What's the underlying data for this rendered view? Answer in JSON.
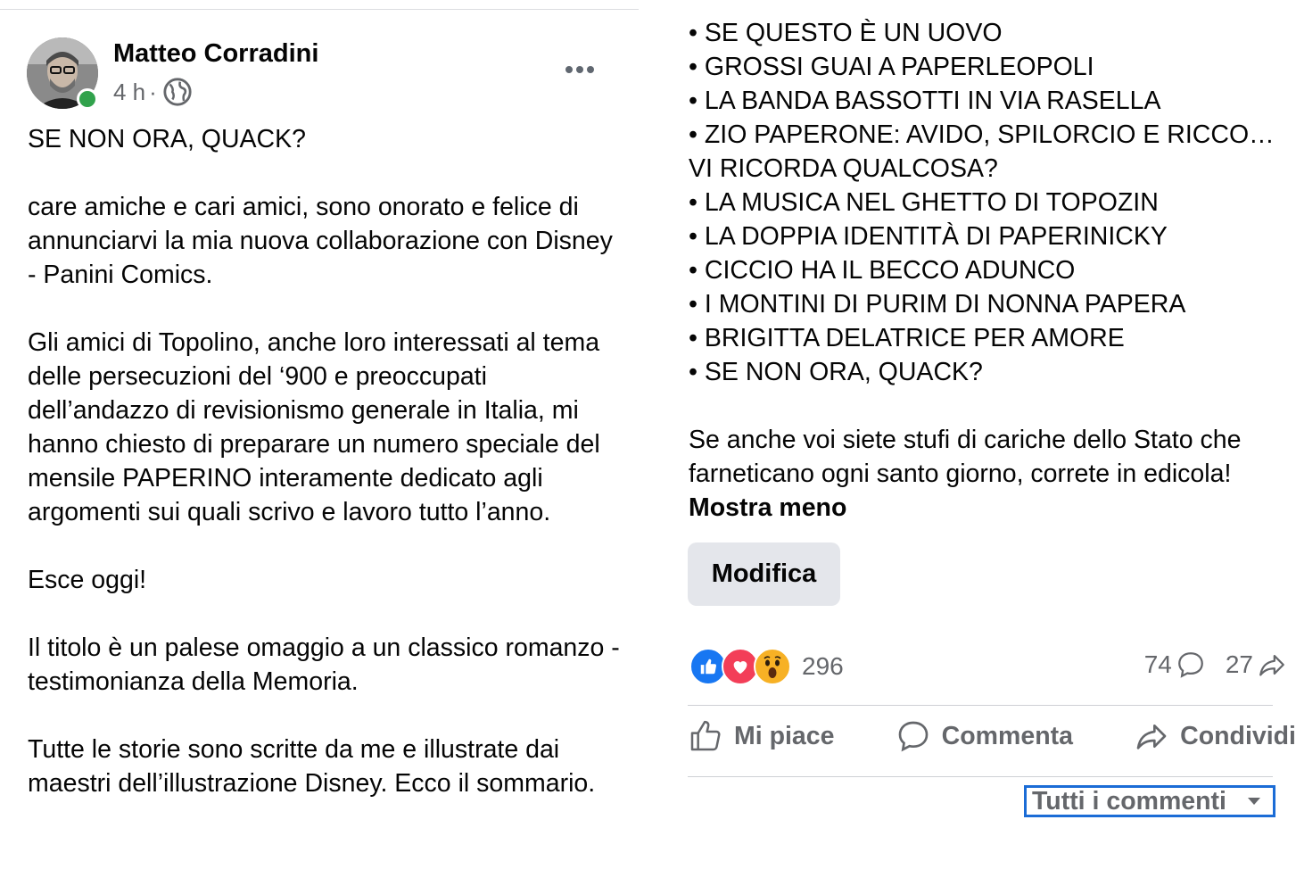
{
  "post": {
    "author": "Matteo Corradini",
    "time": "4 h",
    "time_sep": "·",
    "privacy_icon": "globe-icon",
    "more_icon": "more-options-icon",
    "paragraphs": [
      "SE NON ORA, QUACK?",
      "care amiche e cari amici, sono onorato e felice di annunciarvi la mia nuova collaborazione con Disney - Panini Comics.",
      "Gli amici di Topolino, anche loro interessati al tema delle persecuzioni del ‘900 e preoccupati dell’andazzo di revisionismo generale in Italia, mi hanno chiesto di preparare un numero speciale del mensile PAPERINO interamente dedicato agli argomenti sui quali scrivo e lavoro tutto l’anno.",
      "Esce oggi!",
      "Il titolo è un palese omaggio a un classico romanzo - testimonianza della Memoria.",
      "Tutte le storie sono scritte da me e illustrate dai maestri dell’illustrazione Disney. Ecco il sommario."
    ],
    "list_items": [
      "• SE QUESTO È UN UOVO",
      "• GROSSI GUAI A PAPERLEOPOLI",
      "• LA BANDA BASSOTTI IN VIA RASELLA",
      "• ZIO PAPERONE: AVIDO, SPILORCIO E RICCO…",
      "VI RICORDA QUALCOSA?",
      "• LA MUSICA NEL GHETTO DI TOPOZIN",
      "• LA DOPPIA IDENTITÀ DI PAPERINICKY",
      "• CICCIO HA IL BECCO ADUNCO",
      "• I MONTINI DI PURIM DI NONNA PAPERA",
      "• BRIGITTA DELATRICE PER AMORE",
      "• SE NON ORA, QUACK?"
    ],
    "closing_text": "Se anche voi siete stufi di cariche dello Stato che farneticano ogni santo giorno, correte in edicola!",
    "show_less": "Mostra meno"
  },
  "edit_button": "Modifica",
  "stats": {
    "reactions_count": "296",
    "comments_count": "74",
    "shares_count": "27"
  },
  "actions": {
    "like": "Mi piace",
    "comment": "Commenta",
    "share": "Condividi"
  },
  "comments_filter": "Tutti i commenti",
  "colors": {
    "accent": "#1877f2",
    "focus_border": "#1b6cd6",
    "secondary_text": "#65676b",
    "online": "#31a24c"
  }
}
